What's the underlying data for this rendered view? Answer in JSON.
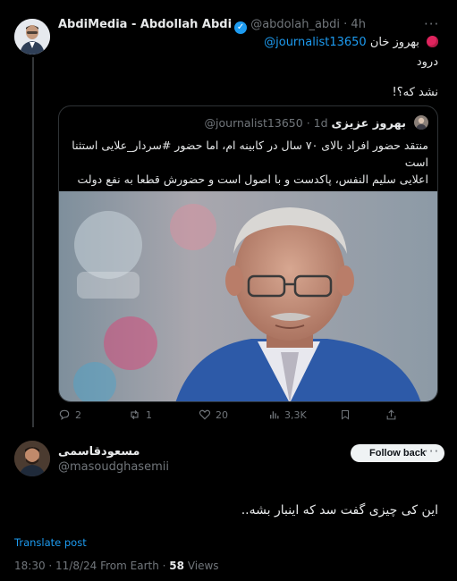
{
  "tweet": {
    "author_name": "AbdiMedia - Abdollah Abdi",
    "handle": "@abdolah_abdi",
    "time": "· 4h",
    "more_glyph": "···",
    "reply_to_name": "بهروز خان",
    "mention": "@journalist13650",
    "line1": "درود",
    "line2": "نشد که؟!",
    "actions": {
      "replies": "2",
      "retweets": "1",
      "likes": "20",
      "views": "3,3K"
    }
  },
  "quote": {
    "author_name": "بهروز عزیزی",
    "handle": "@journalist13650",
    "time": "· 1d",
    "text_line1": "منتقد حضور افراد بالای ۷۰ سال در کابینه ام، اما حضور #سردار_علایی استثنا",
    "text_line2": "است",
    "text_line3": "اعلایی سلیم النفس، پاکدست و با اصول است و حضورش قطعا به نفع دولت"
  },
  "reply": {
    "author_name": "مسعودقاسمی",
    "handle": "@masoudghasemii",
    "follow_label": "Follow back",
    "text": "این کی چیزی گفت سد که اینبار بشه..",
    "translate": "Translate post",
    "meta_time": "18:30 · 11/8/24 From Earth",
    "meta_views_count": "58",
    "meta_views_label": "Views"
  },
  "colors": {
    "background": "#000000",
    "text": "#e7e9ea",
    "muted": "#71767b",
    "accent": "#1d9bf0"
  }
}
